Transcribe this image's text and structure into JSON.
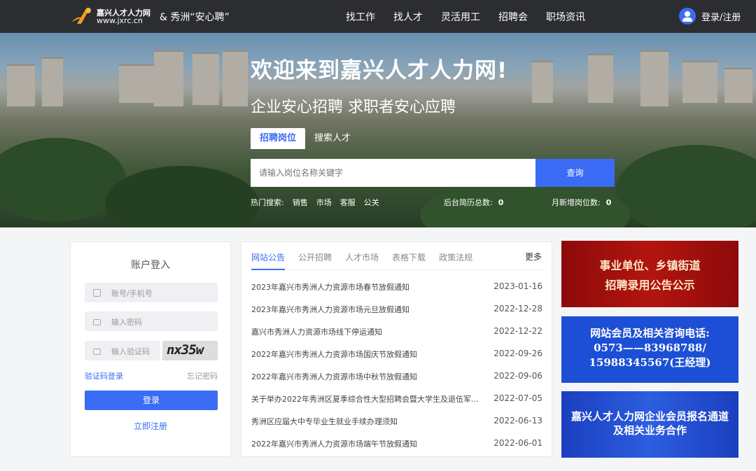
{
  "header": {
    "logo_line1": "嘉兴人才人力网",
    "logo_line2": "www.jxrc.cn",
    "slogan": "& 秀洲“安心聘”",
    "nav": [
      "找工作",
      "找人才",
      "灵活用工",
      "招聘会",
      "职场资讯"
    ],
    "login_label": "登录/注册"
  },
  "hero": {
    "title": "欢迎来到嘉兴人才人力网!",
    "subtitle": "企业安心招聘 求职者安心应聘",
    "tabs": [
      "招聘岗位",
      "搜索人才"
    ],
    "active_tab": "招聘岗位",
    "search_placeholder": "请输入岗位名称关键字",
    "search_button": "查询",
    "hot_label": "热门搜索:",
    "hot_terms": [
      "销售",
      "市场",
      "客服",
      "公关"
    ],
    "stat1_label": "后台简历总数:",
    "stat1_value": "0",
    "stat2_label": "月新增岗位数:",
    "stat2_value": "0"
  },
  "login": {
    "title": "账户登入",
    "account_placeholder": "账号/手机号",
    "password_placeholder": "输入密码",
    "captcha_placeholder": "输入验证码",
    "captcha_text": "nx35w",
    "sms_login": "验证码登录",
    "forgot": "忘记密码",
    "login_button": "登录",
    "register": "立即注册"
  },
  "news": {
    "tabs": [
      "网站公告",
      "公开招聘",
      "人才市场",
      "表格下载",
      "政策法规"
    ],
    "active_tab": "网站公告",
    "more": "更多",
    "items": [
      {
        "title": "2023年嘉兴市秀洲人力资源市场春节放假通知",
        "date": "2023-01-16"
      },
      {
        "title": "2023年嘉兴市秀洲人力资源市场元旦放假通知",
        "date": "2022-12-28"
      },
      {
        "title": "嘉兴市秀洲人力资源市场线下停运通知",
        "date": "2022-12-22"
      },
      {
        "title": "2022年嘉兴市秀洲人力资源市场国庆节放假通知",
        "date": "2022-09-26"
      },
      {
        "title": "2022年嘉兴市秀洲人力资源市场中秋节放假通知",
        "date": "2022-09-06"
      },
      {
        "title": "关于举办2022年秀洲区夏季综合性大型招聘会暨大学生及退伍军...",
        "date": "2022-07-05"
      },
      {
        "title": "秀洲区应届大中专毕业生就业手续办理须知",
        "date": "2022-06-13"
      },
      {
        "title": "2022年嘉兴市秀洲人力资源市场端午节放假通知",
        "date": "2022-06-01"
      }
    ]
  },
  "banners": {
    "b1": [
      "事业单位、乡镇街道",
      "招聘录用公告公示"
    ],
    "b2": [
      "网站会员及相关咨询电话:",
      "0573——83968788/",
      "15988345567(王经理)"
    ],
    "b3": [
      "嘉兴人才人力网企业会员报名通道",
      "及相关业务合作"
    ]
  },
  "colors": {
    "accent": "#3b6cf5",
    "header_bg": "#2b2d31",
    "banner_red": "#b3150f",
    "banner_blue": "#1d4fd6"
  }
}
